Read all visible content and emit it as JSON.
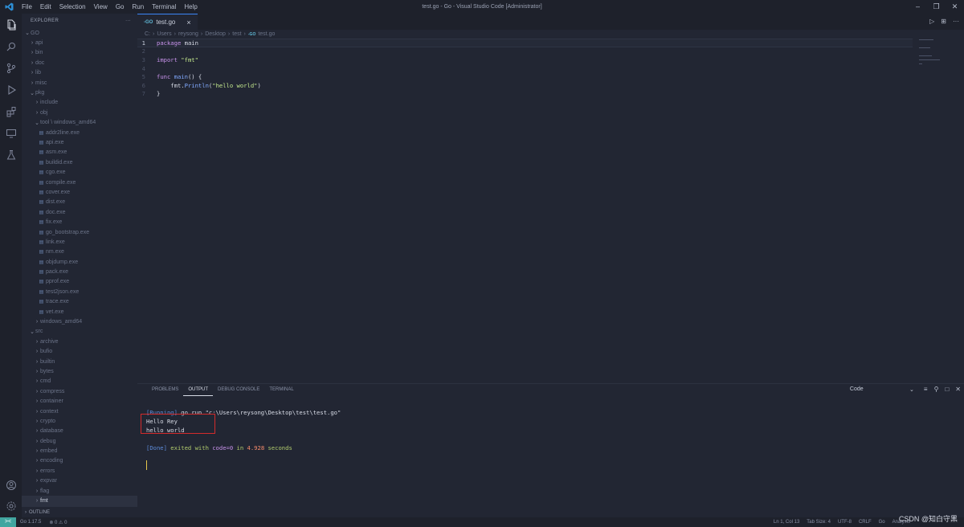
{
  "titlebar": {
    "menu": [
      "File",
      "Edit",
      "Selection",
      "View",
      "Go",
      "Run",
      "Terminal",
      "Help"
    ],
    "title": "test.go - Go - Visual Studio Code [Administrator]"
  },
  "sidebar": {
    "header": "EXPLORER",
    "more": "···",
    "tree": [
      {
        "label": "GO",
        "indent": 0,
        "type": "folder-open"
      },
      {
        "label": "api",
        "indent": 1,
        "type": "folder"
      },
      {
        "label": "bin",
        "indent": 1,
        "type": "folder"
      },
      {
        "label": "doc",
        "indent": 1,
        "type": "folder"
      },
      {
        "label": "lib",
        "indent": 1,
        "type": "folder"
      },
      {
        "label": "misc",
        "indent": 1,
        "type": "folder"
      },
      {
        "label": "pkg",
        "indent": 1,
        "type": "folder-open"
      },
      {
        "label": "include",
        "indent": 2,
        "type": "folder"
      },
      {
        "label": "obj",
        "indent": 2,
        "type": "folder"
      },
      {
        "label": "tool \\ windows_amd64",
        "indent": 2,
        "type": "folder-open"
      },
      {
        "label": "addr2line.exe",
        "indent": 3,
        "type": "file"
      },
      {
        "label": "api.exe",
        "indent": 3,
        "type": "file"
      },
      {
        "label": "asm.exe",
        "indent": 3,
        "type": "file"
      },
      {
        "label": "buildid.exe",
        "indent": 3,
        "type": "file"
      },
      {
        "label": "cgo.exe",
        "indent": 3,
        "type": "file"
      },
      {
        "label": "compile.exe",
        "indent": 3,
        "type": "file"
      },
      {
        "label": "cover.exe",
        "indent": 3,
        "type": "file"
      },
      {
        "label": "dist.exe",
        "indent": 3,
        "type": "file"
      },
      {
        "label": "doc.exe",
        "indent": 3,
        "type": "file"
      },
      {
        "label": "fix.exe",
        "indent": 3,
        "type": "file"
      },
      {
        "label": "go_bootstrap.exe",
        "indent": 3,
        "type": "file"
      },
      {
        "label": "link.exe",
        "indent": 3,
        "type": "file"
      },
      {
        "label": "nm.exe",
        "indent": 3,
        "type": "file"
      },
      {
        "label": "objdump.exe",
        "indent": 3,
        "type": "file"
      },
      {
        "label": "pack.exe",
        "indent": 3,
        "type": "file"
      },
      {
        "label": "pprof.exe",
        "indent": 3,
        "type": "file"
      },
      {
        "label": "test2json.exe",
        "indent": 3,
        "type": "file"
      },
      {
        "label": "trace.exe",
        "indent": 3,
        "type": "file"
      },
      {
        "label": "vet.exe",
        "indent": 3,
        "type": "file"
      },
      {
        "label": "windows_amd64",
        "indent": 2,
        "type": "folder"
      },
      {
        "label": "src",
        "indent": 1,
        "type": "folder-open"
      },
      {
        "label": "archive",
        "indent": 2,
        "type": "folder"
      },
      {
        "label": "bufio",
        "indent": 2,
        "type": "folder"
      },
      {
        "label": "builtin",
        "indent": 2,
        "type": "folder"
      },
      {
        "label": "bytes",
        "indent": 2,
        "type": "folder"
      },
      {
        "label": "cmd",
        "indent": 2,
        "type": "folder"
      },
      {
        "label": "compress",
        "indent": 2,
        "type": "folder"
      },
      {
        "label": "container",
        "indent": 2,
        "type": "folder"
      },
      {
        "label": "context",
        "indent": 2,
        "type": "folder"
      },
      {
        "label": "crypto",
        "indent": 2,
        "type": "folder"
      },
      {
        "label": "database",
        "indent": 2,
        "type": "folder"
      },
      {
        "label": "debug",
        "indent": 2,
        "type": "folder"
      },
      {
        "label": "embed",
        "indent": 2,
        "type": "folder"
      },
      {
        "label": "encoding",
        "indent": 2,
        "type": "folder"
      },
      {
        "label": "errors",
        "indent": 2,
        "type": "folder"
      },
      {
        "label": "expvar",
        "indent": 2,
        "type": "folder"
      },
      {
        "label": "flag",
        "indent": 2,
        "type": "folder"
      },
      {
        "label": "fmt",
        "indent": 2,
        "type": "folder",
        "selected": true
      }
    ],
    "outline": "OUTLINE"
  },
  "editor": {
    "tab": {
      "icon": "-GO",
      "label": "test.go",
      "close": "×"
    },
    "actions": [
      "▷",
      "⊞",
      "···"
    ],
    "breadcrumbs": [
      "C:",
      "Users",
      "reysong",
      "Desktop",
      "test",
      "test.go"
    ],
    "breadcrumb_go_icon": "-GO",
    "lines": [
      {
        "num": "1",
        "tokens": [
          {
            "t": "package ",
            "c": "kw"
          },
          {
            "t": "main",
            "c": "id"
          }
        ]
      },
      {
        "num": "2",
        "tokens": []
      },
      {
        "num": "3",
        "tokens": [
          {
            "t": "import ",
            "c": "kw"
          },
          {
            "t": "\"fmt\"",
            "c": "str"
          }
        ]
      },
      {
        "num": "4",
        "tokens": []
      },
      {
        "num": "5",
        "tokens": [
          {
            "t": "func ",
            "c": "kw"
          },
          {
            "t": "main",
            "c": "fn"
          },
          {
            "t": "() {",
            "c": "id"
          }
        ]
      },
      {
        "num": "6",
        "tokens": [
          {
            "t": "    fmt.",
            "c": "id"
          },
          {
            "t": "Println",
            "c": "fn"
          },
          {
            "t": "(",
            "c": "id"
          },
          {
            "t": "\"hello world\"",
            "c": "str"
          },
          {
            "t": ")",
            "c": "id"
          }
        ]
      },
      {
        "num": "7",
        "tokens": [
          {
            "t": "}",
            "c": "id"
          }
        ]
      }
    ]
  },
  "panel": {
    "tabs": [
      "PROBLEMS",
      "OUTPUT",
      "DEBUG CONSOLE",
      "TERMINAL"
    ],
    "active_tab": "OUTPUT",
    "channel": "Code",
    "output": {
      "running_tag": "[Running]",
      "command": " go run \"c:\\Users\\reysong\\Desktop\\test\\test.go\"",
      "line_hello_rey": "Hello Rey",
      "line_hello_world": "hello world",
      "done_tag": "[Done]",
      "done_text_1": " exited with ",
      "done_code": "code=0",
      "done_text_2": " in ",
      "done_time": "4.928",
      "done_text_3": " seconds"
    }
  },
  "statusbar": {
    "remote": "><",
    "go_version": "Go 1.17.5",
    "problems": "⊗ 0 ⚠ 0",
    "position": "Ln 1, Col 13",
    "tab_size": "Tab Size: 4",
    "encoding": "UTF-8",
    "eol": "CRLF",
    "language": "Go",
    "analysis": "Analysis"
  },
  "watermark": "CSDN @知白守黑",
  "colors": {
    "accent": "#3b86f7",
    "highlight_box": "#d32b2b",
    "remote": "#41a6a0"
  }
}
